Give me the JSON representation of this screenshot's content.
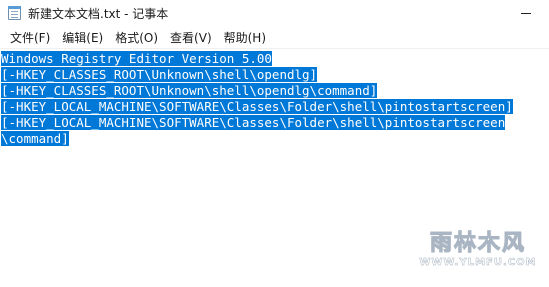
{
  "window": {
    "title": "新建文本文档.txt - 记事本"
  },
  "menu": {
    "file": "文件(F)",
    "edit": "编辑(E)",
    "format": "格式(O)",
    "view": "查看(V)",
    "help": "帮助(H)"
  },
  "editor": {
    "lines": [
      "Windows Registry Editor Version 5.00",
      "[-HKEY_CLASSES_ROOT\\Unknown\\shell\\opendlg]",
      "[-HKEY_CLASSES_ROOT\\Unknown\\shell\\opendlg\\command]",
      "[-HKEY_LOCAL_MACHINE\\SOFTWARE\\Classes\\Folder\\shell\\pintostartscreen]",
      "[-HKEY_LOCAL_MACHINE\\SOFTWARE\\Classes\\Folder\\shell\\pintostartscreen",
      "\\command]"
    ],
    "selection_color": "#0078d7"
  },
  "watermark": {
    "logo_text": "雨林木风",
    "url_text": "WWW.YLMFU.COM"
  },
  "icons": {
    "app": "notepad-icon",
    "minimize": "minimize-icon"
  }
}
